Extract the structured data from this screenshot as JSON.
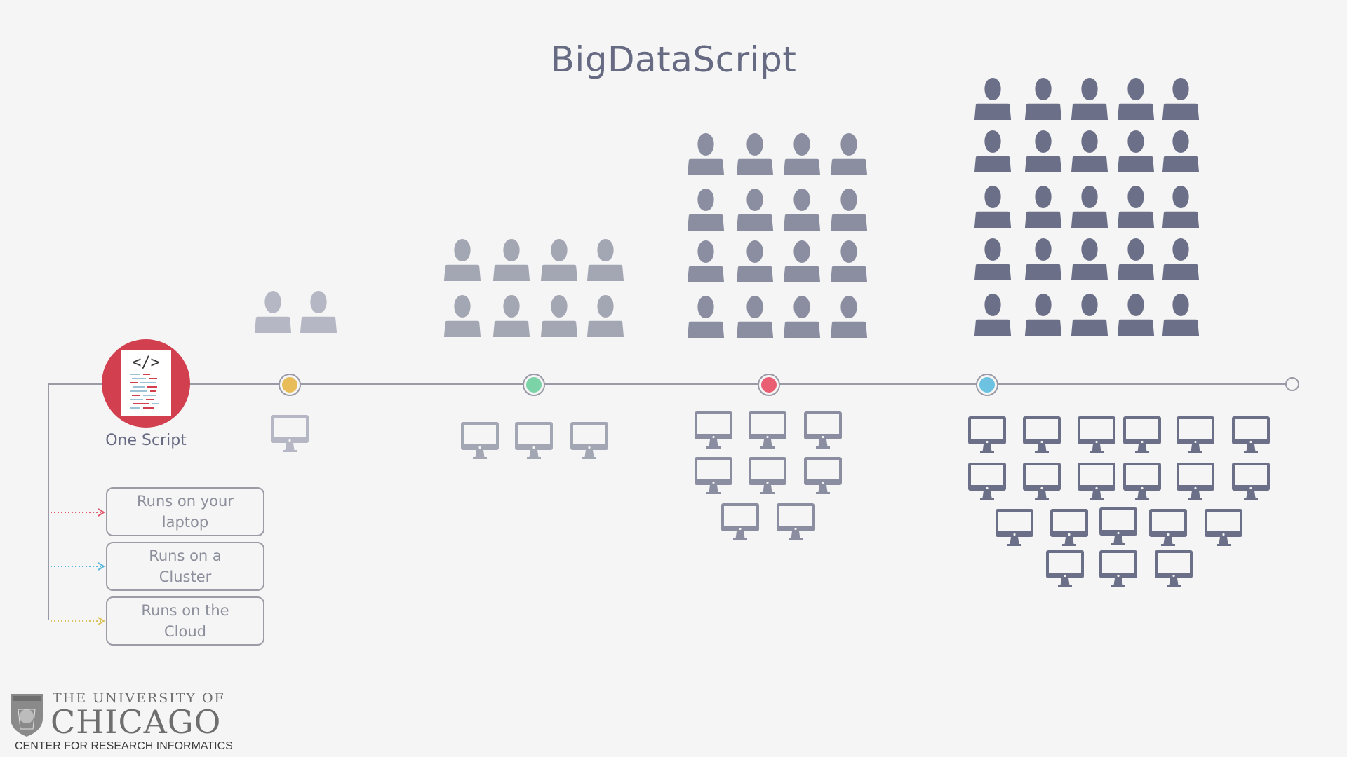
{
  "title": "BigDataScript",
  "one_script_label": "One Script",
  "script_icon_text": "</>",
  "run_boxes": [
    {
      "label": "Runs on your laptop",
      "arrow_color": "#e05a6e"
    },
    {
      "label": "Runs on a Cluster",
      "arrow_color": "#5ab8dc"
    },
    {
      "label": "Runs on the Cloud",
      "arrow_color": "#dcc25a"
    }
  ],
  "milestones": [
    {
      "color": "#e8bc58",
      "people": 2,
      "computers": 1
    },
    {
      "color": "#7dd3a8",
      "people": 8,
      "computers": 3
    },
    {
      "color": "#e95e72",
      "people": 16,
      "computers": 8
    },
    {
      "color": "#6cc2e0",
      "people": 25,
      "computers": 20
    }
  ],
  "logo": {
    "line1": "THE UNIVERSITY OF",
    "line2": "CHICAGO",
    "line3": "CENTER FOR RESEARCH INFORMATICS"
  },
  "colors": {
    "script_circle": "#d23f4f",
    "timeline": "#9a9aa6",
    "group1": "#b5b8c4",
    "group2": "#a3a6b3",
    "group3": "#8a8ea0",
    "group4": "#6b7088"
  }
}
